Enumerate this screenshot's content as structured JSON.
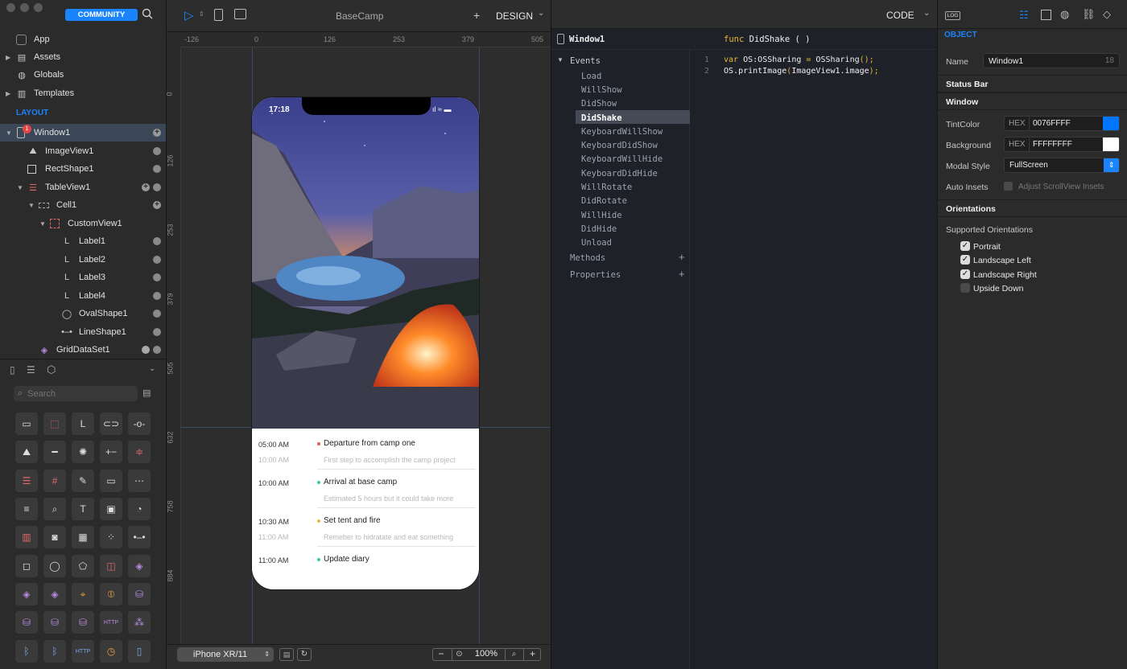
{
  "app": {
    "title": "BaseCamp"
  },
  "left": {
    "community_badge": "COMMUNITY",
    "top_items": [
      "App",
      "Assets",
      "Globals",
      "Templates"
    ],
    "layout_header": "LAYOUT",
    "window_badge": "1",
    "tree": [
      "Window1",
      "ImageView1",
      "RectShape1",
      "TableView1",
      "Cell1",
      "CustomView1",
      "Label1",
      "Label2",
      "Label3",
      "Label4",
      "OvalShape1",
      "LineShape1",
      "GridDataSet1"
    ],
    "search_placeholder": "Search"
  },
  "toolbar": {
    "design_label": "DESIGN",
    "code_label": "CODE",
    "log_label": "LOG",
    "plus": "+"
  },
  "rulers": {
    "h": [
      "-126",
      "0",
      "126",
      "253",
      "379",
      "505"
    ],
    "v": [
      "0",
      "126",
      "253",
      "379",
      "505",
      "632",
      "758",
      "884"
    ]
  },
  "device": {
    "time": "17:18",
    "timeline": [
      {
        "time": "05:00 AM",
        "title": "Departure from camp one",
        "dot": "#e25b5b",
        "sub_time": "10:00 AM",
        "sub": "First step to accomplish the camp project"
      },
      {
        "time": "10:00 AM",
        "title": "Arrival at base camp",
        "dot": "#3fc9a2",
        "sub_time": "",
        "sub": "Estimated 5 hours but it could take more"
      },
      {
        "time": "10:30 AM",
        "title": "Set tent and fire",
        "dot": "#e8b43a",
        "sub_time": "11:00 AM",
        "sub": "Remeber to hidratate and eat something"
      },
      {
        "time": "11:00 AM",
        "title": "Update diary",
        "dot": "#3fc9a2",
        "sub_time": "",
        "sub": ""
      }
    ]
  },
  "bottom": {
    "device_select": "iPhone XR/11",
    "zoom": "100%",
    "minus": "−",
    "plus": "+"
  },
  "code": {
    "window_label": "Window1",
    "func_kw": "func",
    "func_name": "DidShake",
    "func_parens": "(  )",
    "events_header": "Events",
    "events": [
      "Load",
      "WillShow",
      "DidShow",
      "DidShake",
      "KeyboardWillShow",
      "KeyboardDidShow",
      "KeyboardWillHide",
      "KeyboardDidHide",
      "WillRotate",
      "DidRotate",
      "WillHide",
      "DidHide",
      "Unload"
    ],
    "methods": "Methods",
    "properties": "Properties",
    "line_numbers": [
      "1",
      "2"
    ],
    "line1": {
      "kw": "var",
      "name": "OS",
      "colon": ":",
      "type": "OSSharing",
      "eq": " = ",
      "call": "OSSharing",
      "end": "();"
    },
    "line2": {
      "obj": "OS",
      "dot": ".",
      "method": "printImage",
      "open": "(",
      "arg": "ImageView1.image",
      "end": ");"
    }
  },
  "inspector": {
    "object_header": "OBJECT",
    "name_label": "Name",
    "name_value": "Window1",
    "name_count": "18",
    "status_bar": "Status Bar",
    "window_section": "Window",
    "tint_label": "TintColor",
    "hex_label": "HEX",
    "tint_value": "0076FFFF",
    "tint_color": "#0076FF",
    "bg_label": "Background",
    "bg_value": "FFFFFFFF",
    "bg_color": "#FFFFFF",
    "modal_label": "Modal Style",
    "modal_value": "FullScreen",
    "auto_label": "Auto Insets",
    "auto_value": "Adjust ScrollView Insets",
    "orient_section": "Orientations",
    "supported": "Supported Orientations",
    "orientations": [
      {
        "label": "Portrait",
        "checked": true
      },
      {
        "label": "Landscape Left",
        "checked": true
      },
      {
        "label": "Landscape Right",
        "checked": true
      },
      {
        "label": "Upside Down",
        "checked": false
      }
    ]
  },
  "colors": {
    "accent": "#1a84ff",
    "selection": "#3b4656"
  }
}
